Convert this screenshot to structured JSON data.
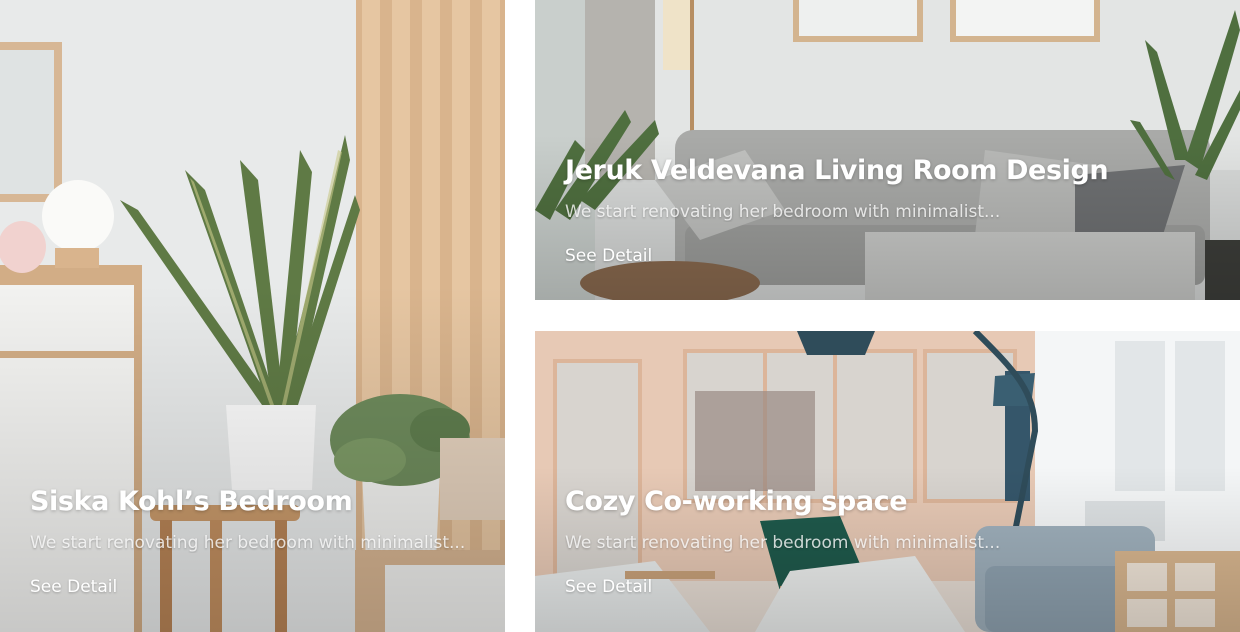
{
  "cards": [
    {
      "title": "Siska Kohl’s Bedroom",
      "description": "We start renovating her bedroom with minimalist...",
      "link_label": "See Detail",
      "photo": "bedroom-plant-image"
    },
    {
      "title": "Jeruk Veldevana Living Room Design",
      "description": "We start renovating her bedroom with minimalist...",
      "link_label": "See Detail",
      "photo": "living-room-sofa-image"
    },
    {
      "title": "Cozy Co-working space",
      "description": "We start renovating her bedroom with minimalist...",
      "link_label": "See Detail",
      "photo": "coworking-space-image"
    }
  ]
}
